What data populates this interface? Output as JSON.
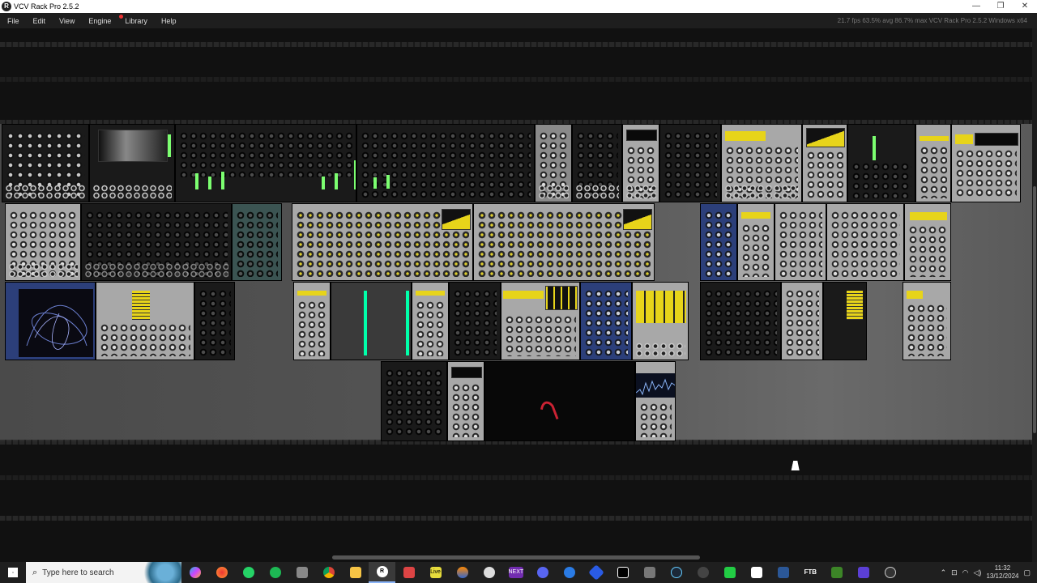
{
  "window": {
    "title": "VCV Rack Pro 2.5.2",
    "minimize": "—",
    "restore": "❐",
    "close": "✕"
  },
  "menu": {
    "items": [
      "File",
      "Edit",
      "View",
      "Engine",
      "Library",
      "Help"
    ],
    "status": "21.7 fps  63.5% avg  86.7% max    VCV Rack Pro 2.5.2 Windows x64"
  },
  "taskbar": {
    "search_placeholder": "Type here to search",
    "time": "11:32",
    "date": "13/12/2024",
    "apps": [
      "copilot",
      "firefox",
      "whatsapp",
      "spotify",
      "app",
      "chrome",
      "file-explorer",
      "vcv-rack",
      "app",
      "live",
      "app",
      "app",
      "next",
      "discord",
      "app",
      "app",
      "capcut",
      "app",
      "steam",
      "app",
      "app",
      "app",
      "app",
      "ftb",
      "minecraft",
      "app",
      "app"
    ],
    "app_labels": {
      "live": "Live",
      "next": "NEXT",
      "ftb": "FTB"
    }
  },
  "colors": {
    "accent_yellow": "#e7d41a",
    "led_green": "#7cff70",
    "scope_blue": "#8ab4f8"
  }
}
